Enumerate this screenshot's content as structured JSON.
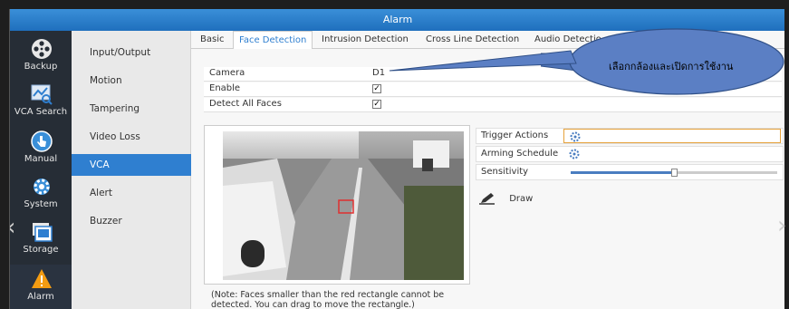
{
  "window": {
    "title": "Alarm"
  },
  "nav": [
    {
      "label": "Backup",
      "icon": "film-reel-icon"
    },
    {
      "label": "VCA Search",
      "icon": "chart-search-icon"
    },
    {
      "label": "Manual",
      "icon": "hand-pointer-icon"
    },
    {
      "label": "System",
      "icon": "gear-icon"
    },
    {
      "label": "Storage",
      "icon": "storage-icon"
    },
    {
      "label": "Alarm",
      "icon": "alarm-warning-icon"
    }
  ],
  "menu": [
    "Input/Output",
    "Motion",
    "Tampering",
    "Video Loss",
    "VCA",
    "Alert",
    "Buzzer"
  ],
  "tabs": [
    "Basic",
    "Face Detection",
    "Intrusion Detection",
    "Cross Line Detection",
    "Audio Detectio"
  ],
  "form": {
    "camera_label": "Camera",
    "camera_value": "D1",
    "enable_label": "Enable",
    "detect_all_label": "Detect All Faces"
  },
  "params": {
    "trigger_label": "Trigger Actions",
    "arming_label": "Arming Schedule",
    "sensitivity_label": "Sensitivity",
    "sensitivity_level": 0.5
  },
  "draw_label": "Draw",
  "note": "(Note: Faces smaller than the red rectangle cannot be detected. You can drag to move the rectangle.)",
  "callout": "เลือกกล้องและเปิดการใช้งาน",
  "colors": {
    "accent": "#2f7fd0",
    "callout": "#4f74b8",
    "nav_bg": "#262d36"
  }
}
